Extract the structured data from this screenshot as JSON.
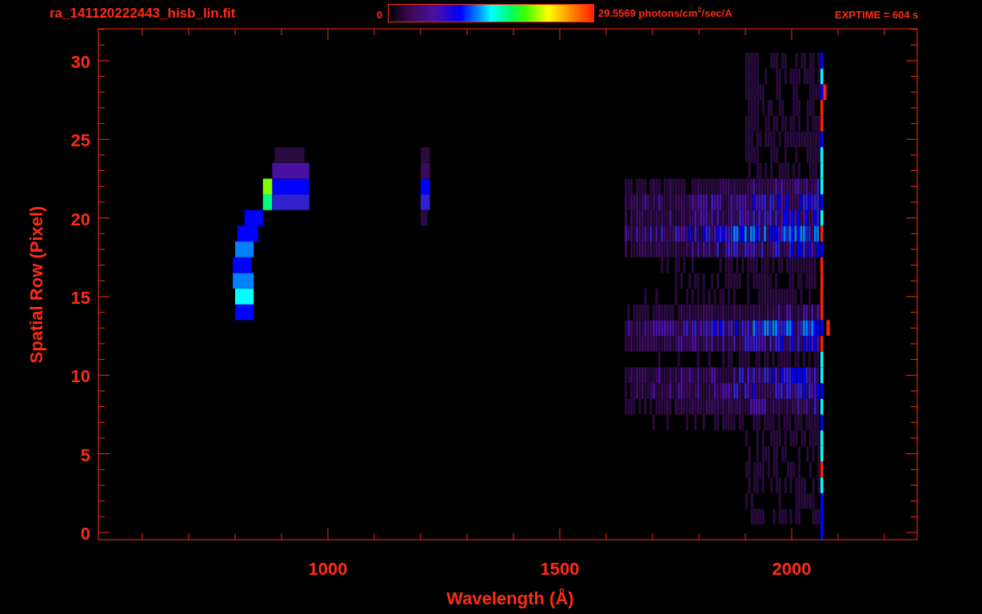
{
  "title": "ra_141120222443_hisb_lin.fit",
  "colorbar": {
    "min_label": "0",
    "max_label": "29.5569 photons/cm$^{2}$/sec/A"
  },
  "exposure": "EXPTIME = 604 s",
  "plot": {
    "xlabel": "Wavelength (Å)",
    "ylabel": "Spatial Row (Pixel)",
    "xtick_labels": [
      "1000",
      "1500",
      "2000"
    ],
    "ytick_labels": [
      "30",
      "25",
      "20",
      "15",
      "10",
      "5",
      "0"
    ]
  }
}
